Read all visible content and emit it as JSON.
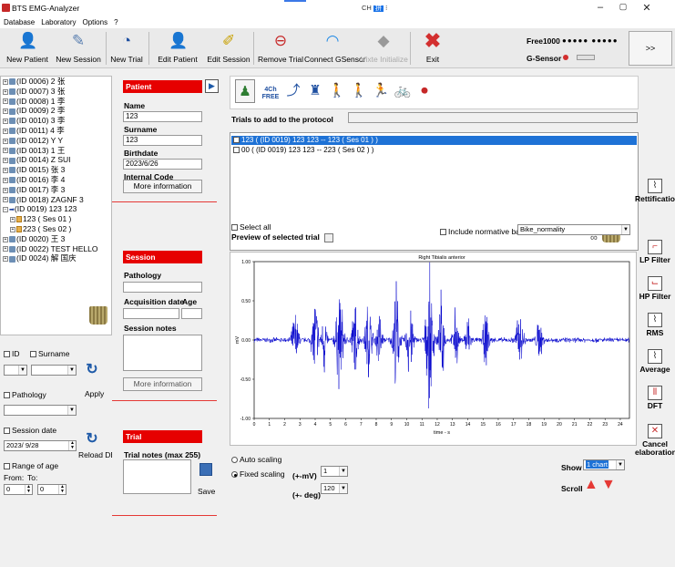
{
  "window": {
    "title": "BTS EMG-Analyzer",
    "ime": {
      "mode": "CH",
      "tag": "拼"
    }
  },
  "menu": [
    "Database",
    "Laboratory",
    "Options",
    "?"
  ],
  "toolbar": {
    "buttons": [
      {
        "label": "New Patient",
        "icon": "person-add-icon"
      },
      {
        "label": "New Session",
        "icon": "syringe-icon"
      },
      {
        "label": "New Trial",
        "icon": "clock-icon"
      },
      {
        "label": "Edit Patient",
        "icon": "person-edit-icon"
      },
      {
        "label": "Edit Session",
        "icon": "notepad-edit-icon"
      },
      {
        "label": "Remove Trial",
        "icon": "remove-trial-icon"
      },
      {
        "label": "Connect GSensor",
        "icon": "wifi-icon"
      },
      {
        "label": "Vixte Initialize",
        "icon": "sensor-init-icon",
        "disabled": true
      },
      {
        "label": "Exit",
        "icon": "exit-x-icon"
      }
    ],
    "free_label": "Free1000",
    "gsensor_label": "G-Sensor",
    "more_label": ">>"
  },
  "tree": [
    {
      "label": "(ID 0006) 2 张"
    },
    {
      "label": "(ID 0007) 3 张"
    },
    {
      "label": "(ID 0008) 1 李"
    },
    {
      "label": "(ID 0009) 2 李"
    },
    {
      "label": "(ID 0010) 3 李"
    },
    {
      "label": "(ID 0011) 4 李"
    },
    {
      "label": "(ID 0012) Y Y"
    },
    {
      "label": "(ID 0013) 1 王"
    },
    {
      "label": "(ID 0014) Z SUI"
    },
    {
      "label": "(ID 0015) 张 3"
    },
    {
      "label": "(ID 0016) 李 4"
    },
    {
      "label": "(ID 0017) 李 3"
    },
    {
      "label": "(ID 0018) ZAGNF 3"
    },
    {
      "label": "(ID 0019) 123 123",
      "selected": true
    },
    {
      "label": "123  ( Ses 01 )",
      "child": true
    },
    {
      "label": "223  ( Ses 02 )",
      "child": true
    },
    {
      "label": "(ID 0020) 王 3"
    },
    {
      "label": "(ID 0022) TEST HELLO"
    },
    {
      "label": "(ID 0024) 解 国庆"
    }
  ],
  "filters": {
    "id_label": "ID",
    "surname_label": "Surname",
    "pathology_label": "Pathology",
    "apply_label": "Apply",
    "session_date_label": "Session date",
    "session_date_value": "2023/ 9/28",
    "reload_label": "Reload DB",
    "range_age_label": "Range of age",
    "from_label": "From:",
    "to_label": "To:",
    "from_value": "0",
    "to_value": "0"
  },
  "patient": {
    "header": "Patient",
    "name_label": "Name",
    "name_value": "123",
    "surname_label": "Surname",
    "surname_value": "123",
    "birthdate_label": "Birthdate",
    "birthdate_value": "2023/6/26",
    "code_label": "Internal Code",
    "code_value": "",
    "more_btn": "More information"
  },
  "session": {
    "header": "Session",
    "pathology_label": "Pathology",
    "acq_label": "Acquisition date",
    "age_label": "Age",
    "notes_label": "Session notes",
    "more_btn": "More information"
  },
  "trial": {
    "header": "Trial",
    "notes_label": "Trial notes (max 255)",
    "save_label": "Save"
  },
  "main": {
    "trial_tools": [
      "person-protocol-icon",
      "kinematic-freq-icon",
      "arm-icon",
      "torso-icon",
      "standing-person-icon",
      "walking-person-icon",
      "gait-icon",
      "bike-icon",
      "record-icon"
    ],
    "trial_tool_freq_label": "4Ch FREE",
    "protocol_label": "Trials to add to the protocol",
    "trials": [
      {
        "label": "123  ( (ID 0019) 123 123 -- 123  ( Ses 01 ) )",
        "checked": true,
        "selected": true
      },
      {
        "label": "00  ( (ID 0019) 123 123 -- 223  ( Ses 02 ) )",
        "checked": false,
        "selected": false
      }
    ],
    "select_all_label": "Select all",
    "normative_label": "Include normative band",
    "normative_value": "Bike_normality",
    "preview_label": "Preview of selected trial",
    "auto_scaling_label": "Auto scaling",
    "fixed_scaling_label": "Fixed scaling",
    "mv_label": "(+-mV)",
    "mv_value": "1",
    "deg_label": "(+- deg)",
    "deg_value": "120",
    "show_label": "Show",
    "show_value": "1 chart",
    "scroll_label": "Scroll"
  },
  "right_tools": [
    {
      "label": "Rettification",
      "icon": "rectification-icon"
    },
    {
      "label": "LP Filter",
      "icon": "lowpass-filter-icon"
    },
    {
      "label": "HP Filter",
      "icon": "highpass-filter-icon"
    },
    {
      "label": "RMS",
      "icon": "rms-icon"
    },
    {
      "label": "Average",
      "icon": "average-icon"
    },
    {
      "label": "DFT",
      "icon": "dft-icon"
    },
    {
      "label": "Cancel elaboration",
      "icon": "cancel-elaboration-icon"
    }
  ],
  "chart_data": {
    "type": "line",
    "title": "Right Tibialis anterior",
    "xlabel": "time - s",
    "ylabel": "mV",
    "xlim": [
      0,
      24.6
    ],
    "ylim": [
      -1.0,
      1.0
    ],
    "xticks": [
      0,
      1,
      2,
      3,
      4,
      5,
      6,
      7,
      8,
      9,
      10,
      11,
      12,
      13,
      14,
      15,
      16,
      17,
      18,
      19,
      20,
      21,
      22,
      23,
      24
    ],
    "yticks": [
      "1.00",
      "0.50",
      "0.00",
      "-0.50",
      "-1.00"
    ],
    "bursts": [
      {
        "center": 2.7,
        "width": 0.5,
        "peak": 0.35
      },
      {
        "center": 4.0,
        "width": 0.5,
        "peak": 0.55
      },
      {
        "center": 4.6,
        "width": 0.35,
        "peak": 0.45
      },
      {
        "center": 5.6,
        "width": 0.6,
        "peak": 0.6
      },
      {
        "center": 6.6,
        "width": 0.5,
        "peak": 0.45
      },
      {
        "center": 7.5,
        "width": 0.5,
        "peak": 0.55
      },
      {
        "center": 8.2,
        "width": 0.4,
        "peak": 0.4
      },
      {
        "center": 9.3,
        "width": 0.5,
        "peak": 0.7
      },
      {
        "center": 10.2,
        "width": 0.5,
        "peak": 0.55
      },
      {
        "center": 11.5,
        "width": 0.6,
        "peak": 0.8
      },
      {
        "center": 12.3,
        "width": 0.4,
        "peak": 0.6
      },
      {
        "center": 13.2,
        "width": 0.4,
        "peak": 0.4
      },
      {
        "center": 14.0,
        "width": 0.4,
        "peak": 0.35
      },
      {
        "center": 15.2,
        "width": 0.5,
        "peak": 0.3
      },
      {
        "center": 17.4,
        "width": 0.6,
        "peak": 0.35
      },
      {
        "center": 18.7,
        "width": 0.5,
        "peak": 0.25
      }
    ],
    "baseline": 0.03,
    "color": "#0000cc"
  }
}
